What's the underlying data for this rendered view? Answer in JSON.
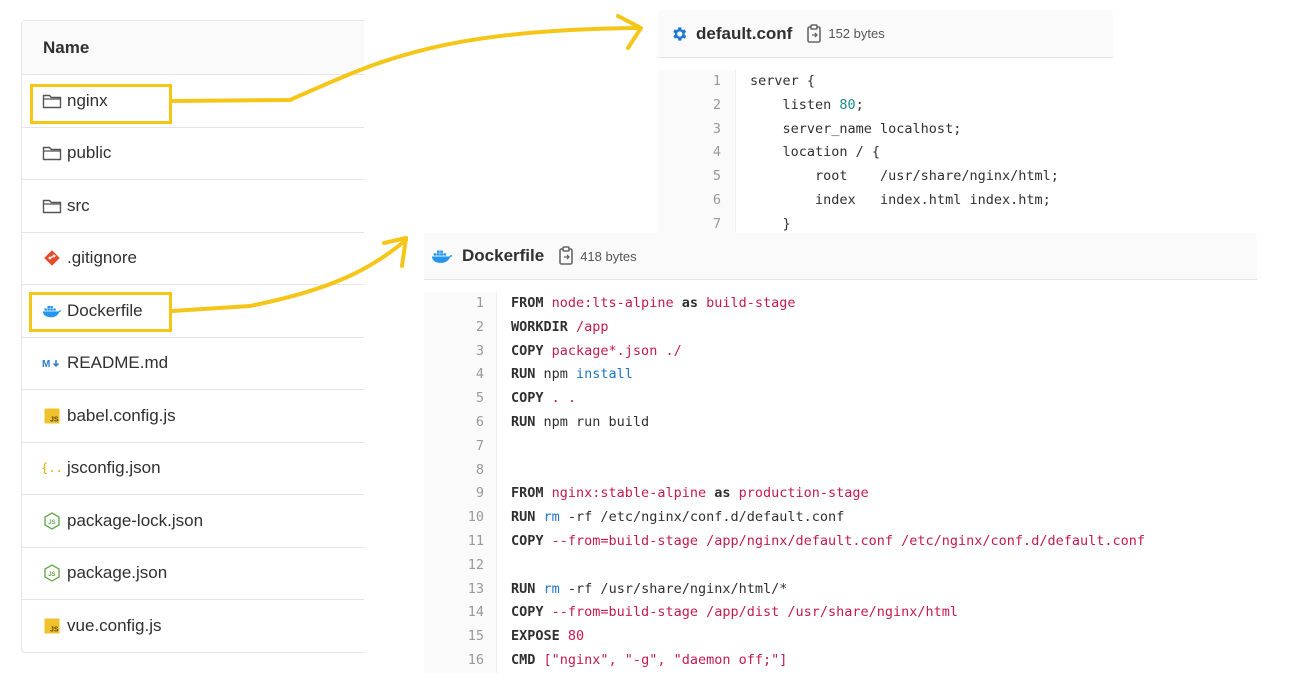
{
  "file_list": {
    "header": "Name",
    "files": [
      {
        "name": "nginx",
        "icon": "folder-icon"
      },
      {
        "name": "public",
        "icon": "folder-icon"
      },
      {
        "name": "src",
        "icon": "folder-icon"
      },
      {
        "name": ".gitignore",
        "icon": "git-icon"
      },
      {
        "name": "Dockerfile",
        "icon": "docker-icon"
      },
      {
        "name": "README.md",
        "icon": "markdown-icon"
      },
      {
        "name": "babel.config.js",
        "icon": "js-icon"
      },
      {
        "name": "jsconfig.json",
        "icon": "json-braces-icon"
      },
      {
        "name": "package-lock.json",
        "icon": "nodejs-icon"
      },
      {
        "name": "package.json",
        "icon": "nodejs-icon"
      },
      {
        "name": "vue.config.js",
        "icon": "js-icon"
      }
    ]
  },
  "default_conf": {
    "title": "default.conf",
    "size": "152 bytes",
    "icon": "gear-icon",
    "lines": [
      "server {",
      "    listen 80;",
      "    server_name localhost;",
      "    location / {",
      "        root    /usr/share/nginx/html;",
      "        index   index.html index.htm;",
      "    }",
      "}"
    ]
  },
  "dockerfile": {
    "title": "Dockerfile",
    "size": "418 bytes",
    "icon": "docker-icon",
    "lines": [
      "FROM node:lts-alpine as build-stage",
      "WORKDIR /app",
      "COPY package*.json ./",
      "RUN npm install",
      "COPY . .",
      "RUN npm run build",
      "",
      "",
      "FROM nginx:stable-alpine as production-stage",
      "RUN rm -rf /etc/nginx/conf.d/default.conf",
      "COPY --from=build-stage /app/nginx/default.conf /etc/nginx/conf.d/default.conf",
      "",
      "RUN rm -rf /usr/share/nginx/html/*",
      "COPY --from=build-stage /app/dist /usr/share/nginx/html",
      "EXPOSE 80",
      "CMD [\"nginx\", \"-g\", \"daemon off;\"]"
    ]
  },
  "colors": {
    "highlight": "#f5c518",
    "string": "#c41a4d",
    "number": "#1f8a8a",
    "builtin": "#2275c7",
    "docker_blue": "#2496ed",
    "gear_blue": "#1f78d1"
  }
}
